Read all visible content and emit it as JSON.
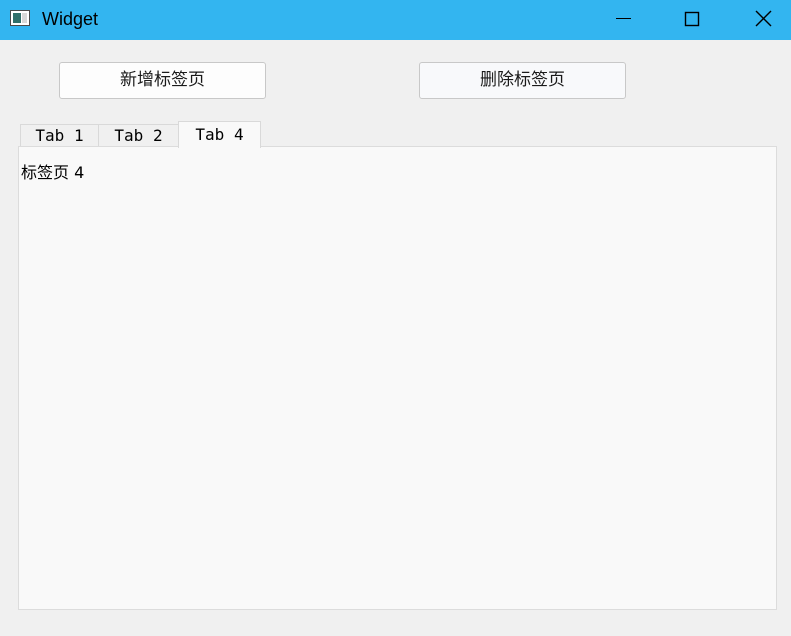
{
  "window": {
    "title": "Widget",
    "icon": "app-window-icon",
    "controls": {
      "minimize": "minimize-icon",
      "maximize": "maximize-icon",
      "close": "close-icon"
    },
    "accent": "#33b5f0"
  },
  "toolbar": {
    "add_label": "新增标签页",
    "delete_label": "删除标签页"
  },
  "tabs": {
    "items": [
      {
        "label": "Tab 1",
        "selected": false
      },
      {
        "label": "Tab 2",
        "selected": false
      },
      {
        "label": "Tab 4",
        "selected": true
      }
    ]
  },
  "content": {
    "text": "标签页 4"
  }
}
